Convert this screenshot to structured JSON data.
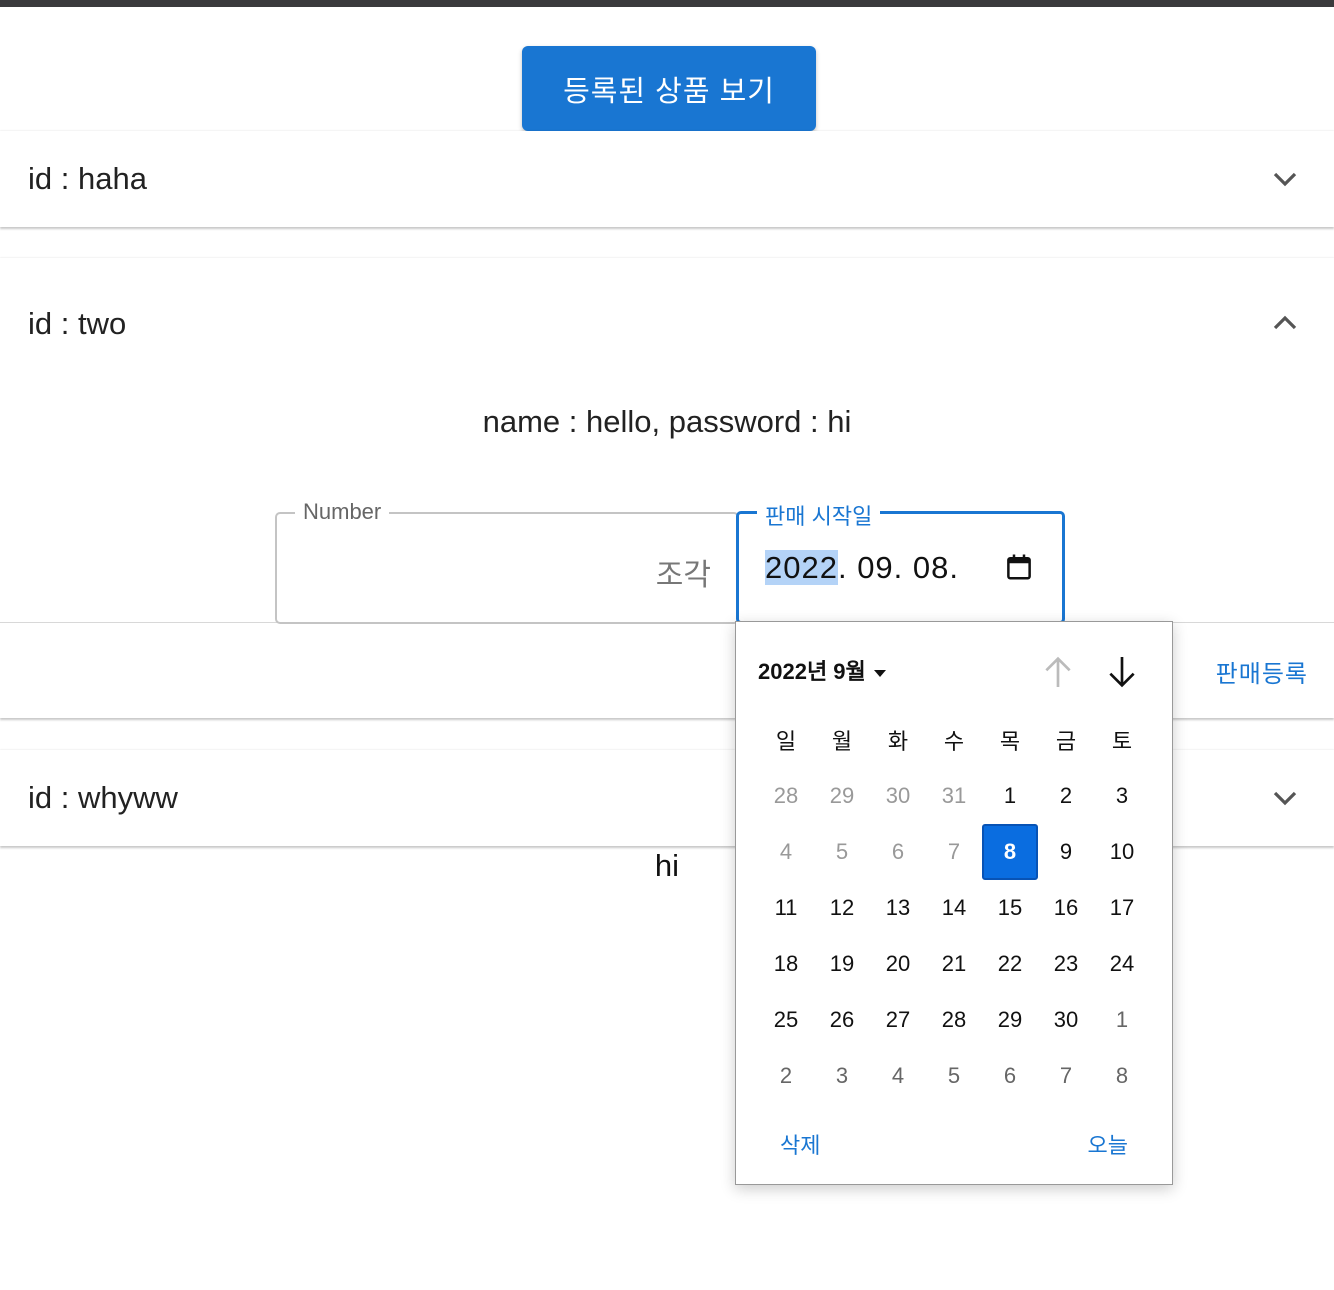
{
  "header": {
    "view_button": "등록된 상품 보기"
  },
  "panels": [
    {
      "title": "id : haha",
      "expanded": false
    },
    {
      "title": "id : two",
      "expanded": true,
      "detail": "name : hello, password : hi",
      "number_field": {
        "label": "Number",
        "value": "",
        "adornment": "조각"
      },
      "date_field": {
        "label": "판매 시작일",
        "year": "2022",
        "rest": ". 09. 08."
      },
      "register_button": "판매등록"
    },
    {
      "title": "id : whyww",
      "expanded": false,
      "detail": "hi"
    }
  ],
  "calendar": {
    "month_label": "2022년 9월",
    "weekdays": [
      "일",
      "월",
      "화",
      "수",
      "목",
      "금",
      "토"
    ],
    "weeks": [
      [
        "28",
        "29",
        "30",
        "31",
        "1",
        "2",
        "3"
      ],
      [
        "4",
        "5",
        "6",
        "7",
        "8",
        "9",
        "10"
      ],
      [
        "11",
        "12",
        "13",
        "14",
        "15",
        "16",
        "17"
      ],
      [
        "18",
        "19",
        "20",
        "21",
        "22",
        "23",
        "24"
      ],
      [
        "25",
        "26",
        "27",
        "28",
        "29",
        "30",
        "1"
      ],
      [
        "2",
        "3",
        "4",
        "5",
        "6",
        "7",
        "8"
      ]
    ],
    "selected_day": "8",
    "clear_label": "삭제",
    "today_label": "오늘",
    "accent_color": "#1976d2"
  }
}
